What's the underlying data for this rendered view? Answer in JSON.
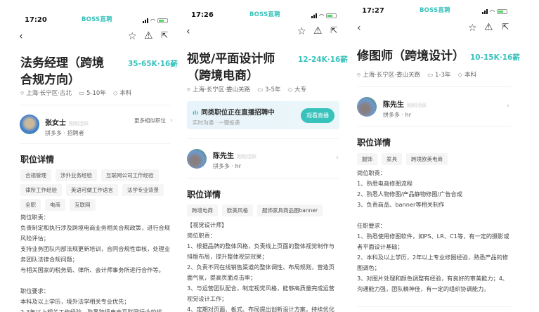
{
  "brand": "BOSS直聘",
  "panels": [
    {
      "time": "17:20",
      "title": "法务经理（跨境合规方向）",
      "salary": "35-65K·16薪",
      "location": "上海·长宁区·古北",
      "experience": "5-10年",
      "education": "本科",
      "recruiter": {
        "name": "张女士",
        "active": "刚刚活跃",
        "company": "拼多多 · 招聘者",
        "more": "更多相似职位"
      },
      "section_title": "职位详情",
      "tags": [
        "合规管理",
        "涉外业务经验",
        "互联网公司工作经验",
        "律所工作经验",
        "英语可做工作语言",
        "法学专业背景",
        "全职",
        "电商",
        "互联网"
      ],
      "body": "岗位职责：\n负责制定和执行涉及跨境电商业务相关合规政策，进行合规风险评估；\n支持业务团队内部法规更新培训，合同合规性审核，处理业务团队法律合规问题；\n与相关国家的税务局、律所、会计师事务所进行合作等。\n\n职位要求：\n本科及以上学历，境外法学相关专业优先；\n2-3年以上相关工作经验，熟悉跨境电商互联网行业的优"
    },
    {
      "time": "17:26",
      "title": "视觉/平面设计师（跨境电商）",
      "salary": "12-24K·16薪",
      "location": "上海·长宁区·娄山关路",
      "experience": "3-5年",
      "education": "大专",
      "live": {
        "title": "同类职位正在直播招聘中",
        "subtitle": "实时沟通 · 一键投递",
        "button": "观看直播"
      },
      "recruiter": {
        "name": "陈先生",
        "active": "刚刚活跃",
        "company": "拼多多 · hr"
      },
      "section_title": "职位详情",
      "tags": [
        "跨境电商",
        "欧美风格",
        "服饰家具商品图banner"
      ],
      "body": "【视觉设计师】\n岗位职责：\n1、根据品牌的整体风格，负责线上页面的整体视觉制作与排版布局，提升整体视觉效果；\n2、负责不同在线销售渠道的整体调性、布局规则，营造页面气氛，提高页面点击率；\n3、与运营团队配合，制定视觉风格，能够高质量完成运营视觉设计工作；\n4、定期对页面、板式、布局提出创新设计方案，持续优化页"
    },
    {
      "time": "17:27",
      "title": "修图师（跨境设计）",
      "salary": "10-15K·16薪",
      "location": "上海·长宁区·娄山关路",
      "experience": "1-3年",
      "education": "本科",
      "recruiter": {
        "name": "陈先生",
        "active": "刚刚活跃",
        "company": "拼多多 · hr"
      },
      "section_title": "职位详情",
      "tags": [
        "服饰",
        "家具",
        "跨境欧美电商"
      ],
      "body": "岗位职责：\n1、熟悉电商修图流程\n2、熟悉人物修图/产品静物修图/广告合成\n3、负责商品、banner等相关制作\n\n任职要求：\n1、熟悉使用修图软件，如PS、LR、C1等，有一定的摄影或者平面设计基础；\n2、本科及以上学历，2年以上专业修图经验，熟悉产品的修图调色；\n3、对图片处理和颜色调整有经验，有良好的审美能力；4、沟通能力强，团队精神佳，有一定的组织协调能力。"
    }
  ]
}
